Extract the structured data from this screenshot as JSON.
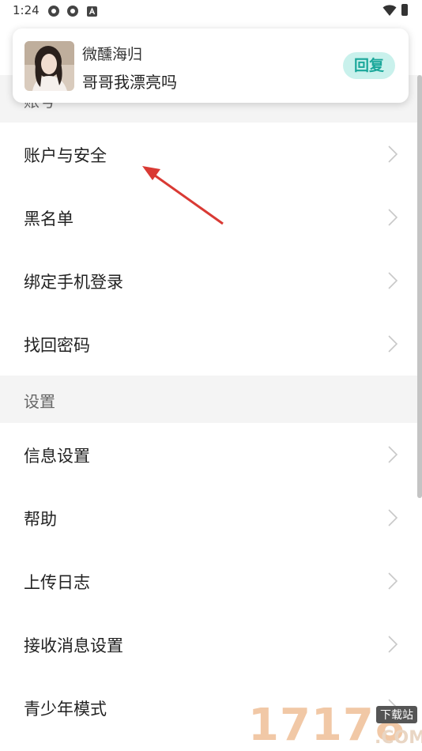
{
  "status_bar": {
    "time": "1:24",
    "icons": [
      "app-icon",
      "app-icon",
      "a-square-icon"
    ],
    "right_icons": [
      "wifi-icon",
      "battery-icon"
    ]
  },
  "notification": {
    "sender": "微醺海归",
    "message": "哥哥我漂亮吗",
    "reply_label": "回复",
    "accent_color": "#1aa79a"
  },
  "sections": [
    {
      "title": "账号",
      "items": [
        {
          "label": "账户与安全"
        },
        {
          "label": "黑名单"
        },
        {
          "label": "绑定手机登录"
        },
        {
          "label": "找回密码"
        }
      ]
    },
    {
      "title": "设置",
      "items": [
        {
          "label": "信息设置"
        },
        {
          "label": "帮助"
        },
        {
          "label": "上传日志"
        },
        {
          "label": "接收消息设置"
        },
        {
          "label": "青少年模式"
        }
      ]
    }
  ],
  "watermark": {
    "number": "17178",
    "tag": "下载站",
    "suffix": ".COM"
  }
}
